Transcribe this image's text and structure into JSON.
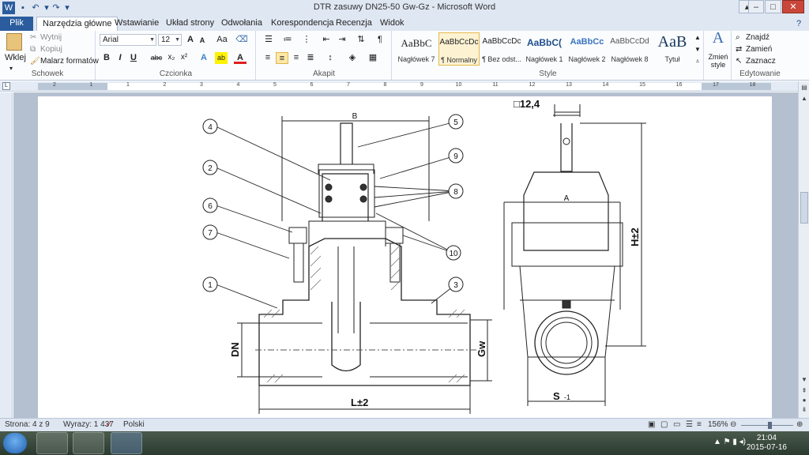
{
  "window": {
    "title": "DTR zasuwy DN25-50 Gw-Gz  -  Microsoft Word",
    "controls": {
      "minimize": "–",
      "maximize": "□",
      "close": "✕"
    }
  },
  "quick_access": {
    "save_icon": "save-icon",
    "undo_icon": "undo-icon",
    "redo_icon": "redo-icon",
    "customize_icon": "customize-icon"
  },
  "tabs": [
    {
      "label": "Plik"
    },
    {
      "label": "Narzędzia główne"
    },
    {
      "label": "Wstawianie"
    },
    {
      "label": "Układ strony"
    },
    {
      "label": "Odwołania"
    },
    {
      "label": "Korespondencja"
    },
    {
      "label": "Recenzja"
    },
    {
      "label": "Widok"
    }
  ],
  "ribbon": {
    "clipboard": {
      "label": "Schowek",
      "paste": "Wklej",
      "cut": "Wytnij",
      "copy": "Kopiuj",
      "format_painter": "Malarz formatów"
    },
    "font": {
      "label": "Czcionka",
      "font_name": "Arial",
      "font_size": "12",
      "grow": "A",
      "shrink": "A",
      "change_case": "Aa",
      "bold": "B",
      "italic": "I",
      "underline": "U",
      "strike": "abc",
      "subscript": "x₂",
      "superscript": "x²",
      "font_color": "A"
    },
    "paragraph": {
      "label": "Akapit",
      "show_marks": "¶"
    },
    "styles": {
      "label": "Style",
      "items": [
        {
          "preview": "AaBbC",
          "name": "Nagłówek 7"
        },
        {
          "preview": "AaBbCcDc",
          "name": "¶ Normalny"
        },
        {
          "preview": "AaBbCcDc",
          "name": "¶ Bez odst..."
        },
        {
          "preview": "AaBbC(",
          "name": "Nagłówek 1"
        },
        {
          "preview": "AaBbCc",
          "name": "Nagłówek 2"
        },
        {
          "preview": "AaBbCcDd",
          "name": "Nagłówek 8"
        },
        {
          "preview": "AaB",
          "name": "Tytuł"
        }
      ],
      "change_styles": "Zmień style"
    },
    "editing": {
      "label": "Edytowanie",
      "find": "Znajdź",
      "replace": "Zamień",
      "select": "Zaznacz"
    }
  },
  "ruler": {
    "numbers": [
      "2",
      "1",
      "1",
      "2",
      "3",
      "4",
      "5",
      "6",
      "7",
      "8",
      "9",
      "10",
      "11",
      "12",
      "13",
      "14",
      "15",
      "16",
      "17",
      "18"
    ]
  },
  "drawing": {
    "callouts": [
      "4",
      "2",
      "6",
      "7",
      "1",
      "5",
      "9",
      "8",
      "10",
      "3"
    ],
    "dim_B": "B",
    "dim_A": "A",
    "dim_square": "□12,4",
    "dim_H": "H±2",
    "dim_DN": "DN",
    "dim_Gw": "Gw",
    "dim_L": "L±2",
    "dim_S": "S",
    "dim_S_tol": "-1"
  },
  "status": {
    "page": "Strona: 4 z 9",
    "words": "Wyrazy: 1 437",
    "language": "Polski",
    "zoom": "156%"
  },
  "taskbar": {
    "time": "21:04",
    "date": "2015-07-16"
  }
}
